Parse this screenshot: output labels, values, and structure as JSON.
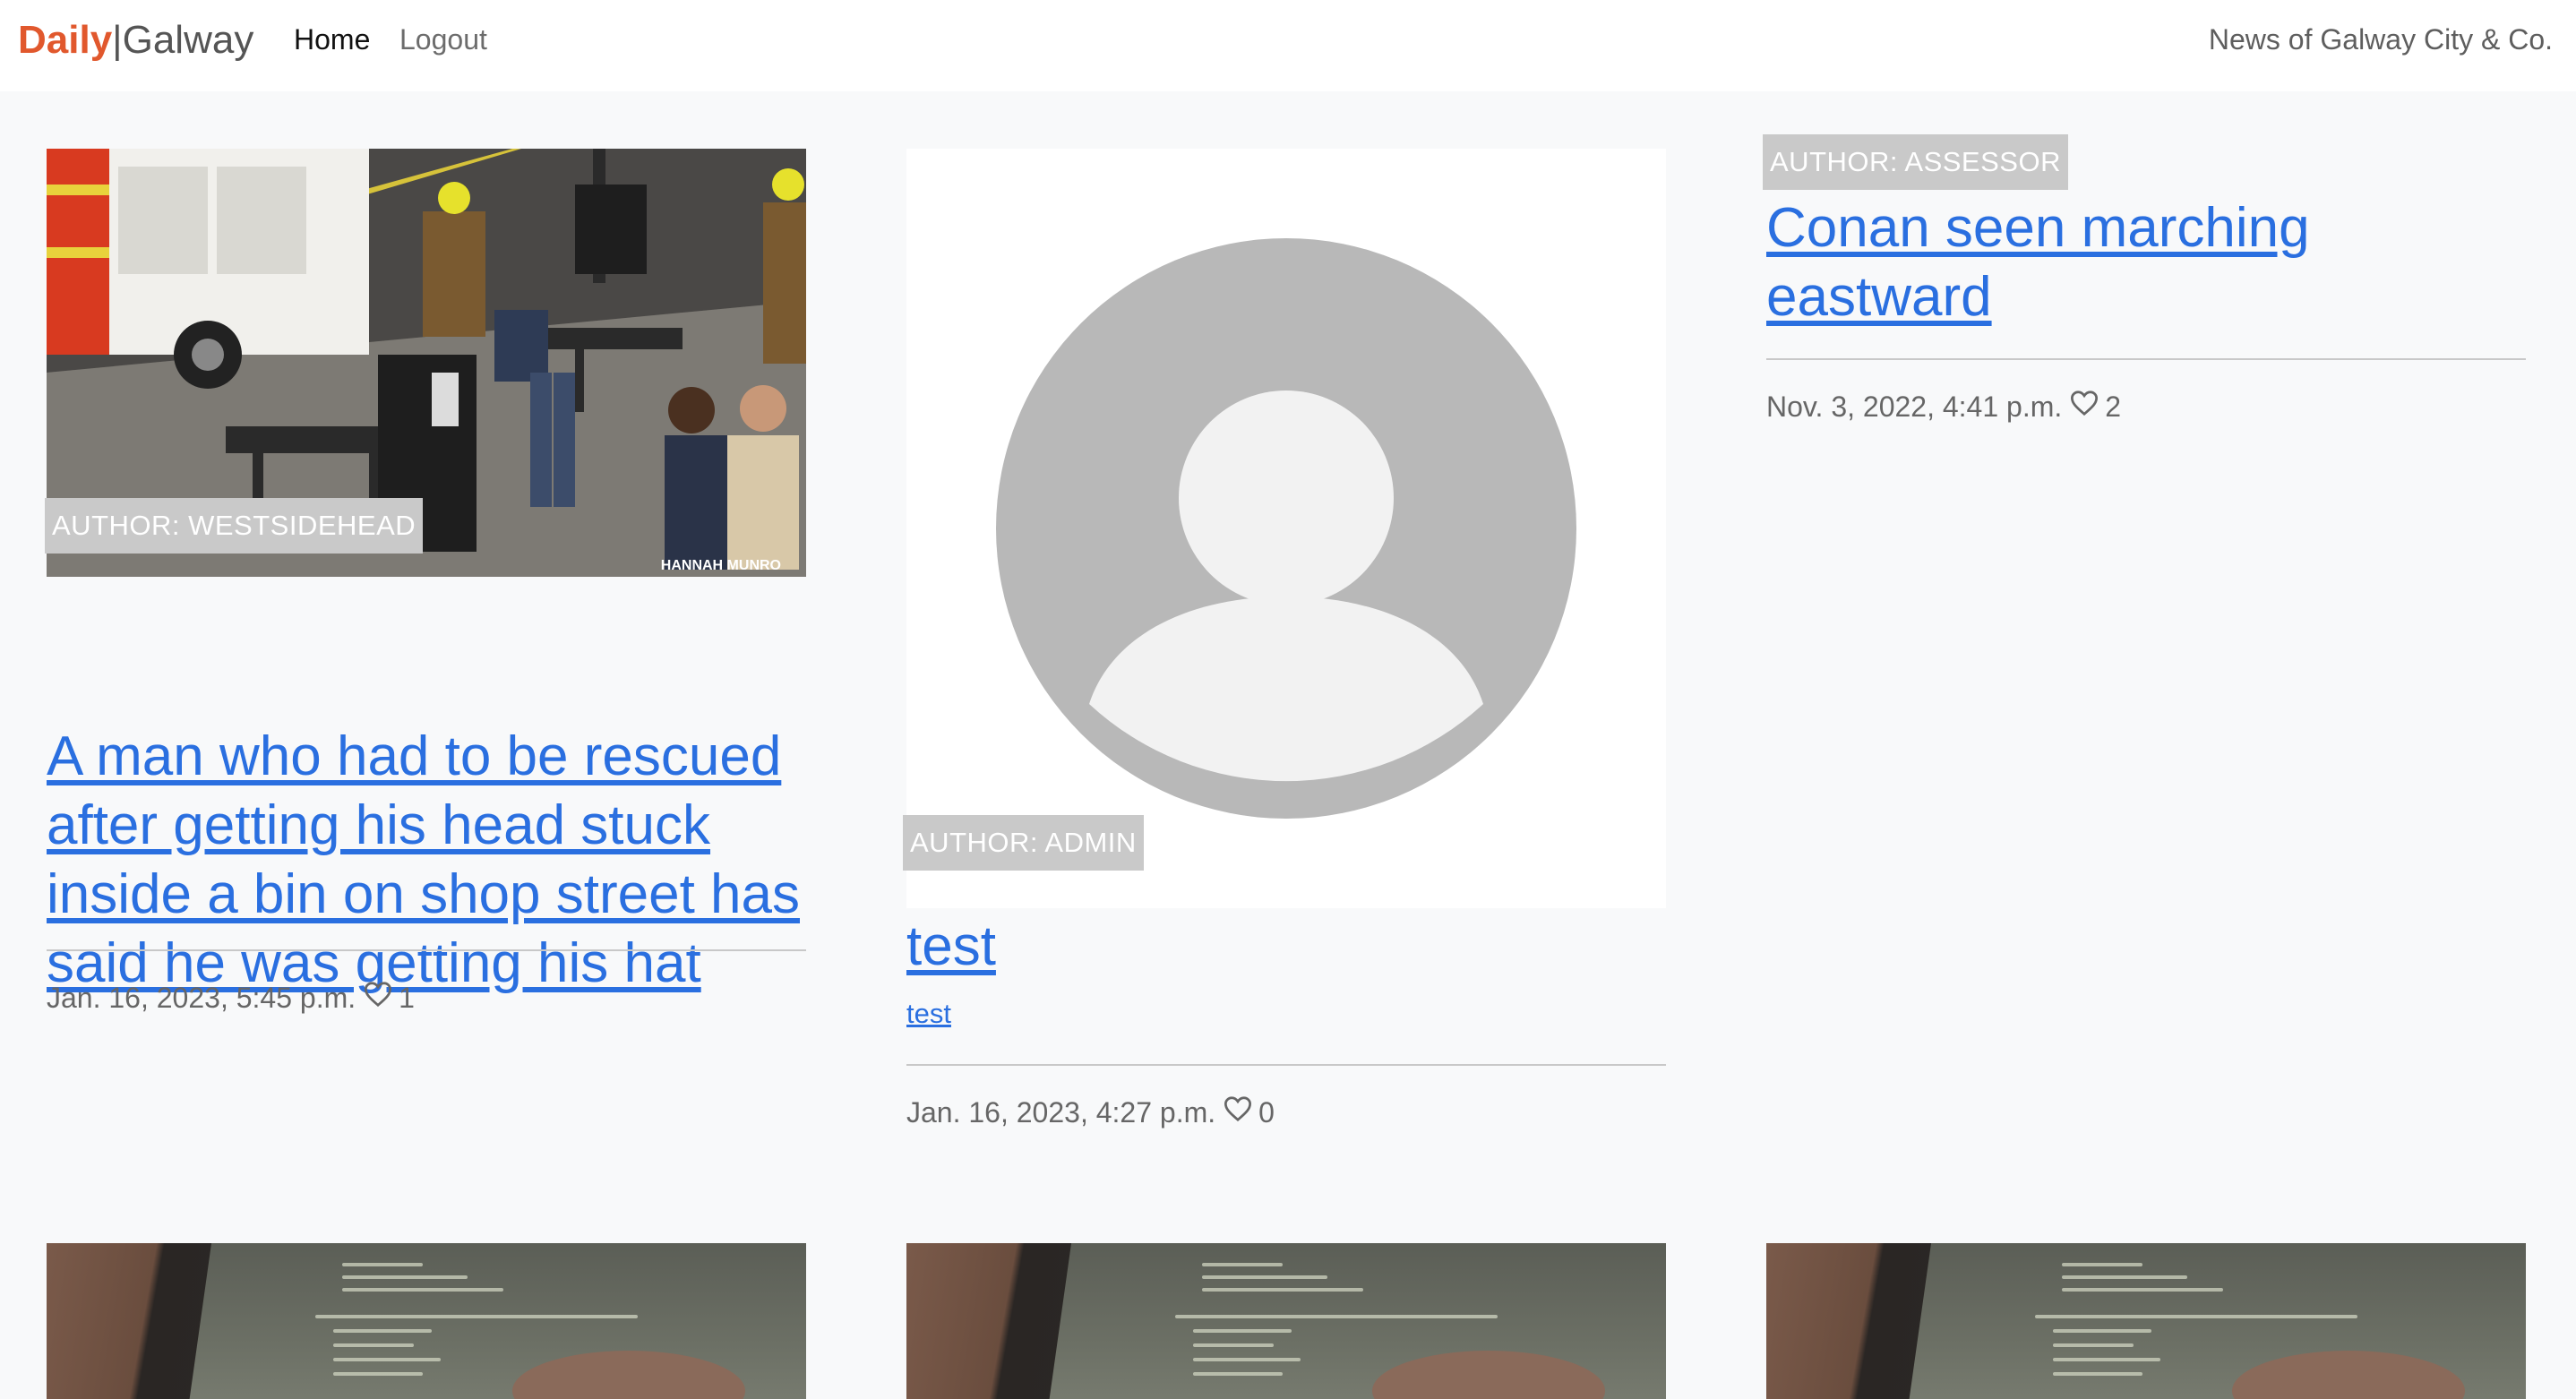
{
  "navbar": {
    "brand_daily": "Daily",
    "brand_sep": "|",
    "brand_galway": "Galway",
    "home_label": "Home",
    "logout_label": "Logout",
    "tagline": "News of Galway City & Co."
  },
  "posts": [
    {
      "author": "AUTHOR: WESTSIDEHEAD",
      "title": "A man who had to be rescued after getting his head stuck inside a bin on shop street has said he was getting his hat",
      "date": "Jan. 16, 2023, 5:45 p.m.",
      "likes": "1",
      "image_caption": "HANNAH MUNRO"
    },
    {
      "author": "AUTHOR: ADMIN",
      "title": "test",
      "subtitle": "test",
      "date": "Jan. 16, 2023, 4:27 p.m.",
      "likes": "0"
    },
    {
      "author": "AUTHOR: ASSESSOR",
      "title": "Conan seen marching eastward",
      "date": "Nov. 3, 2022, 4:41 p.m.",
      "likes": "2"
    }
  ],
  "colors": {
    "brand_accent": "#e1582d",
    "link": "#2a6fe0",
    "badge_bg": "#c9c9c9",
    "page_bg": "#f8f9fa"
  },
  "icons": {
    "like": "heart-outline-icon",
    "avatar": "default-avatar-icon"
  }
}
